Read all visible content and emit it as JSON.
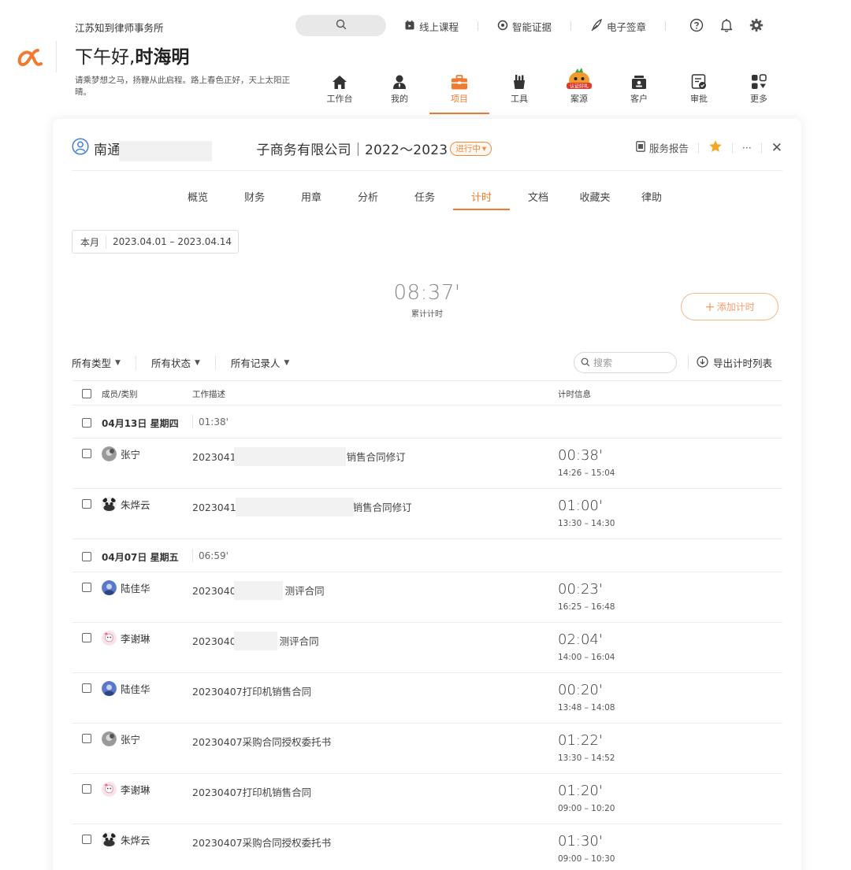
{
  "header": {
    "firm_name": "江苏知到律师事务所",
    "greeting_prefix": "下午好,",
    "user_name": "时海明",
    "motto": "请乘梦想之马，扬鞭从此启程。路上春色正好，天上太阳正晴。",
    "top_links": [
      {
        "label": "线上课程",
        "icon": "calendar-icon"
      },
      {
        "label": "智能证据",
        "icon": "evidence-icon"
      },
      {
        "label": "电子签章",
        "icon": "pen-icon"
      }
    ],
    "top_icons": [
      "help-icon",
      "bell-icon",
      "gear-icon"
    ]
  },
  "nav": [
    {
      "label": "工作台",
      "icon": "home-icon",
      "active": false
    },
    {
      "label": "我的",
      "icon": "user-icon",
      "active": false
    },
    {
      "label": "项目",
      "icon": "briefcase-icon",
      "active": true
    },
    {
      "label": "工具",
      "icon": "tools-icon",
      "active": false
    },
    {
      "label": "案源",
      "icon": "case-source-icon",
      "active": false,
      "badge": "认证好礼"
    },
    {
      "label": "客户",
      "icon": "client-icon",
      "active": false
    },
    {
      "label": "审批",
      "icon": "approval-icon",
      "active": false
    },
    {
      "label": "更多",
      "icon": "more-apps-icon",
      "active": false
    }
  ],
  "project": {
    "name": "南通　　　　　　　　　　子商务有限公司｜2022～2023",
    "status": "进行中",
    "actions": {
      "report": "服务报告",
      "more": "···",
      "close": "✕"
    }
  },
  "tabs": [
    "概览",
    "财务",
    "用章",
    "分析",
    "任务",
    "计时",
    "文档",
    "收藏夹",
    "律助"
  ],
  "active_tab": "计时",
  "date_filter": {
    "mode": "本月",
    "range": "2023.04.01 – 2023.04.14"
  },
  "total": {
    "value": "08:37'",
    "label": "累计计时"
  },
  "add_button": "添加计时",
  "filters": [
    "所有类型",
    "所有状态",
    "所有记录人"
  ],
  "search": {
    "placeholder": "搜索"
  },
  "export_label": "导出计时列表",
  "table": {
    "headers": {
      "member": "成员/类别",
      "desc": "工作描述",
      "time": "计时信息"
    },
    "groups": [
      {
        "date": "04月13日 星期四",
        "sum": "01:38'",
        "rows": [
          {
            "member": "张宁",
            "avatar": "avatar-gray",
            "desc_prefix": "2023041",
            "desc_suffix": "销售合同修订",
            "time": "00:38'",
            "range": "14:26 – 15:04"
          },
          {
            "member": "朱烨云",
            "avatar": "avatar-panda",
            "desc_prefix": "2023041",
            "desc_suffix": "销售合同修订",
            "time": "01:00'",
            "range": "13:30 – 14:30"
          }
        ]
      },
      {
        "date": "04月07日 星期五",
        "sum": "06:59'",
        "rows": [
          {
            "member": "陆佳华",
            "avatar": "avatar-blue",
            "desc_prefix": "2023040",
            "desc_suffix": "测评合同",
            "time": "00:23'",
            "range": "16:25 – 16:48"
          },
          {
            "member": "李谢琳",
            "avatar": "avatar-pink",
            "desc_prefix": "2023040",
            "desc_suffix": "测评合同",
            "time": "02:04'",
            "range": "14:00 – 16:04"
          },
          {
            "member": "陆佳华",
            "avatar": "avatar-blue",
            "desc_prefix": "20230407打印机销售合同",
            "desc_suffix": "",
            "time": "00:20'",
            "range": "13:48 – 14:08"
          },
          {
            "member": "张宁",
            "avatar": "avatar-gray",
            "desc_prefix": "20230407采购合同授权委托书",
            "desc_suffix": "",
            "time": "01:22'",
            "range": "13:30 – 14:52"
          },
          {
            "member": "李谢琳",
            "avatar": "avatar-pink",
            "desc_prefix": "20230407打印机销售合同",
            "desc_suffix": "",
            "time": "01:20'",
            "range": "09:00 – 10:20"
          },
          {
            "member": "朱烨云",
            "avatar": "avatar-panda",
            "desc_prefix": "20230407采购合同授权委托书",
            "desc_suffix": "",
            "time": "01:30'",
            "range": "09:00 – 10:30"
          }
        ]
      }
    ]
  },
  "colors": {
    "accent": "#f07a2f",
    "star": "#f5a623",
    "border": "#ececec"
  }
}
